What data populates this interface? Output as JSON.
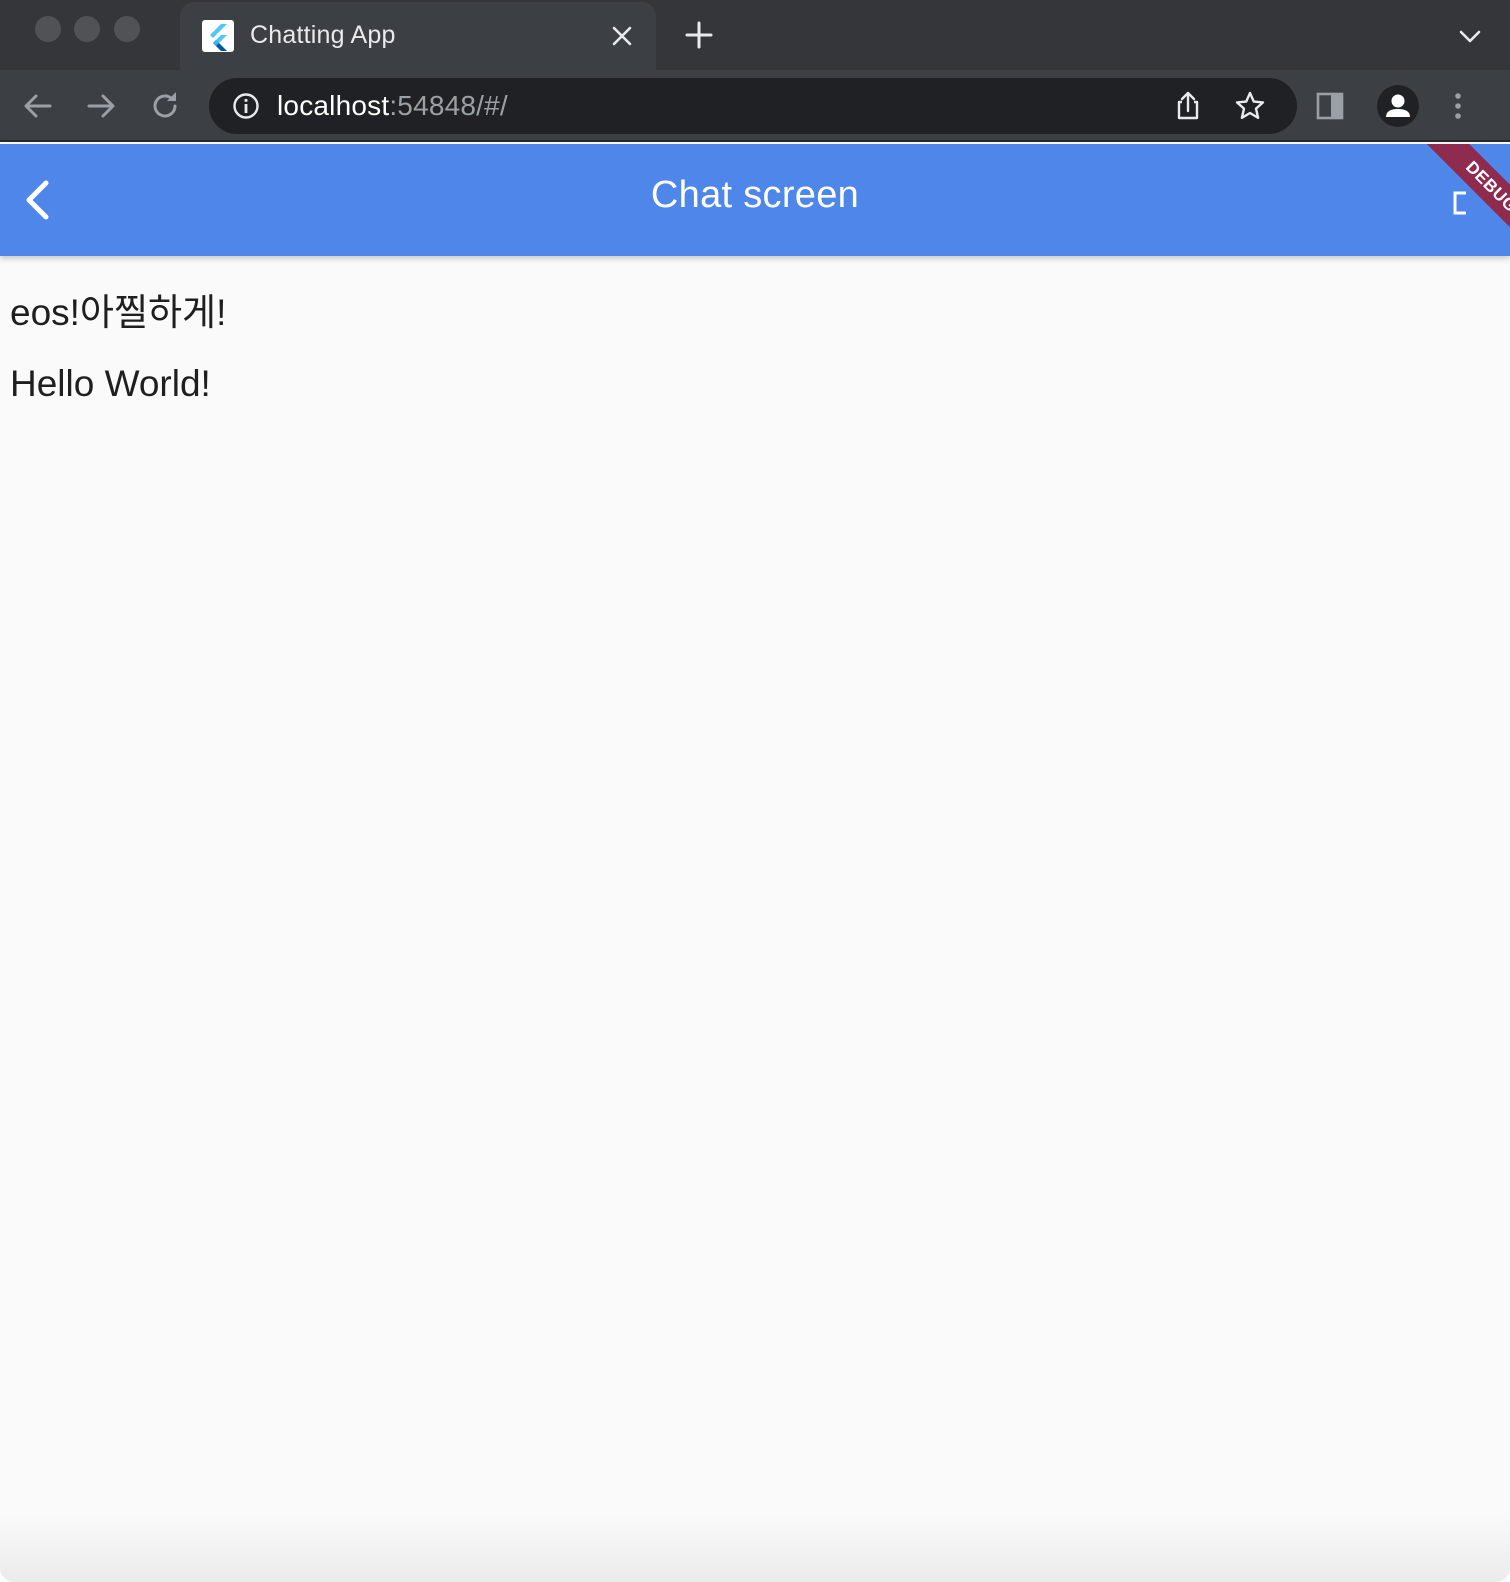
{
  "browser": {
    "tab": {
      "title": "Chatting App"
    },
    "address": {
      "host": "localhost",
      "rest": ":54848/#/"
    }
  },
  "app": {
    "title": "Chat screen",
    "debug_label": "DEBUG",
    "messages": [
      {
        "text": "eos!아찔하게!"
      },
      {
        "text": "Hello World!"
      }
    ]
  },
  "colors": {
    "app_bar": "#4f86ea",
    "debug_ribbon": "#8e2b4f",
    "tab_strip": "#35363a",
    "toolbar": "#3c3f43",
    "omnibox": "#202124"
  }
}
